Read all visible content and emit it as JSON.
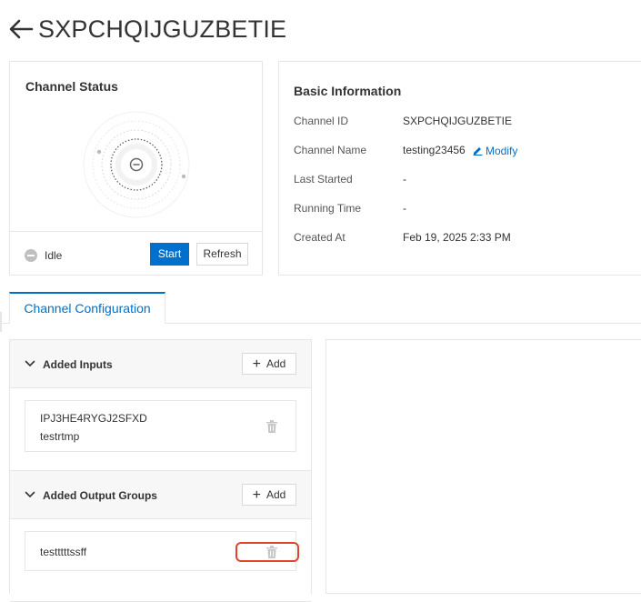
{
  "header": {
    "title": "SXPCHQIJGUZBETIE",
    "back_icon": "arrow-left-icon"
  },
  "channel_status": {
    "title": "Channel Status",
    "state": "Idle",
    "start_label": "Start",
    "refresh_label": "Refresh"
  },
  "basic_info": {
    "title": "Basic Information",
    "rows": [
      {
        "label": "Channel ID",
        "value": "SXPCHQIJGUZBETIE"
      },
      {
        "label": "Channel Name",
        "value": "testing23456"
      },
      {
        "label": "Last Started",
        "value": "-"
      },
      {
        "label": "Running Time",
        "value": "-"
      },
      {
        "label": "Created At",
        "value": "Feb 19, 2025 2:33 PM"
      }
    ],
    "modify_label": "Modify"
  },
  "tabs": [
    {
      "label": "Channel Configuration",
      "active": true
    }
  ],
  "config": {
    "inputs": {
      "title": "Added Inputs",
      "add_label": "Add",
      "items": [
        {
          "id": "IPJ3HE4RYGJ2SFXD",
          "name": "testrtmp"
        }
      ]
    },
    "output_groups": {
      "title": "Added Output Groups",
      "add_label": "Add",
      "items": [
        {
          "name": "testttttssff"
        }
      ]
    }
  },
  "colors": {
    "accent": "#0070cc",
    "highlight": "#e0452c",
    "idle_gray": "#bfbfbf"
  }
}
